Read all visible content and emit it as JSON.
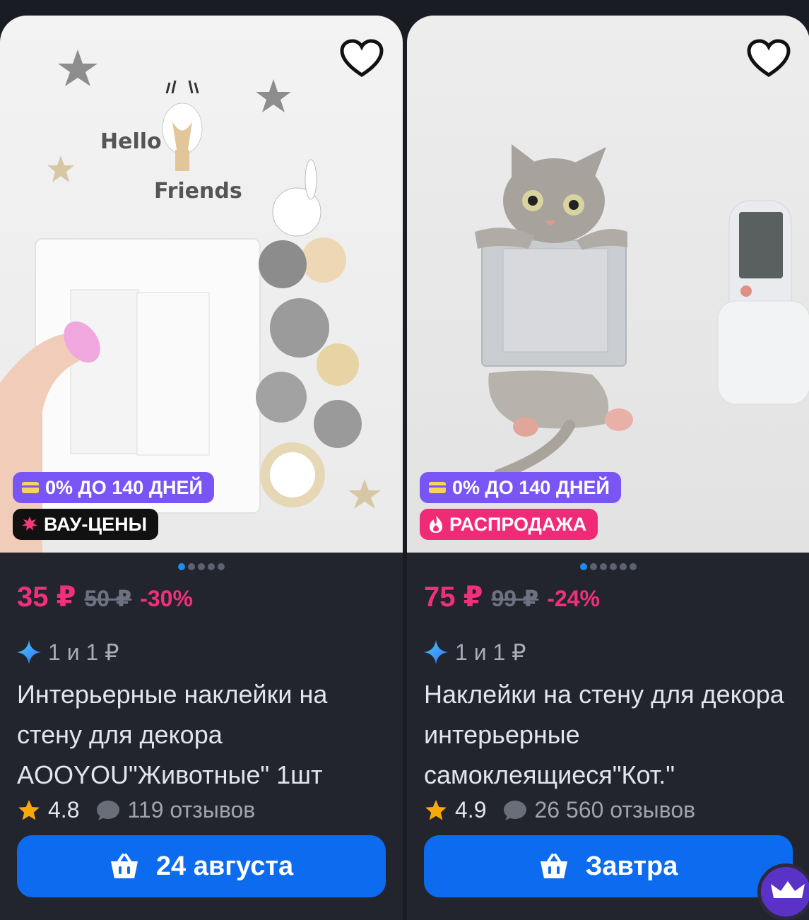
{
  "products": [
    {
      "badges": {
        "bnpl": "0% ДО 140 ДНЕЙ",
        "promo": "ВАУ-ЦЕНЫ"
      },
      "image_text": {
        "hello": "Hello",
        "friends": "Friends"
      },
      "price": "35 ₽",
      "old_price": "50 ₽",
      "discount": "-30%",
      "promo_text": "1 и 1 ₽",
      "title": "Интерьерные наклейки на стену для декора AOOYOU\"Животные\" 1шт",
      "rating": "4.8",
      "reviews": "119 отзывов",
      "delivery": "24 августа"
    },
    {
      "badges": {
        "bnpl": "0% ДО 140 ДНЕЙ",
        "promo": "РАСПРОДАЖА"
      },
      "price": "75 ₽",
      "old_price": "99 ₽",
      "discount": "-24%",
      "promo_text": "1 и 1 ₽",
      "title": "Наклейки на стену для декора интерьерные самоклеящиеся\"Кот.\"",
      "rating": "4.9",
      "reviews": "26 560 отзывов",
      "delivery": "Завтра"
    }
  ],
  "colors": {
    "price": "#f0307d",
    "button": "#0d6bf0",
    "bnpl_badge": "#7a55f5",
    "sale_badge": "#ef2b77"
  },
  "icons": [
    "heart-icon",
    "card-icon",
    "star-burst-icon",
    "flame-icon",
    "sparkle-icon",
    "star-icon",
    "comment-icon",
    "basket-icon",
    "crown-icon"
  ]
}
